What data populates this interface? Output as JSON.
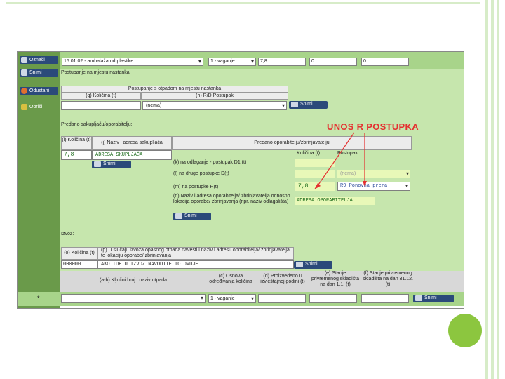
{
  "top_bar": {
    "oznaci": "Označi",
    "waste_code": "15 01 02 - ambalaža od plastike",
    "measure": "1 - vaganje",
    "qty": "7,8",
    "col5": "0",
    "col6": "0"
  },
  "sidebar": {
    "snimi": "Snimi",
    "odustani": "Odustani",
    "obrisi": "Obriši"
  },
  "postupanje": {
    "title": "Postupanje na mjestu nastanka:",
    "subheader": "Postupanje s otpadom na mjestu nastanka",
    "col_a": "(g) Količina (t)",
    "col_b": "(h) R/D Postupak",
    "select": "(nema)",
    "save": "Snimi"
  },
  "predano": {
    "title": "Predano sakupljaču/oporabitelju:",
    "h_kolicina": "(i) Količina (t)",
    "h_naziv": "(j) Naziv i adresa sakupljača",
    "h_predano": "Predano oporabitelju/zbrinjavatelju",
    "qty": "7,8",
    "adresa": "ADRESA SKUPLJAČA",
    "save1": "Snimi",
    "col_kol": "Količina (t)",
    "col_post": "Postupak",
    "row_k": "(k) na odlaganje - postupak D1 (t)",
    "row_l": "(l) na druge postupke D(t)",
    "row_l_select": "(nema)",
    "row_m": "(m) na postupke R(t)",
    "row_m_qty": "7,8",
    "row_m_select": "R9 Ponovna prera",
    "row_n": "(n) Naziv i adresa oporabitelja/ zbrinjavatelja odnosno lokacija oporabe/ zbrinjavanja (npr. naziv odlagališta)",
    "row_n_value": "ADRESA OPORABITELJA",
    "save2": "Snimi"
  },
  "callout": "UNOS R POSTUPKA",
  "izvoz": {
    "title": "Izvoz:",
    "h_kolicina": "(o) Količina (t)",
    "h_text": "(p) U slučaju izvoza opasnog otpada navesti i naziv i adresu oporabitelja/ zbrinjavatelja te lokaciju oporabe/ zbrinjavanja",
    "qty": "000000",
    "text": "AKO IDE U IZVOZ NAVODITE TO OVDJE",
    "save": "Snimi"
  },
  "bottom": {
    "h1": "(a-b) Ključni broj i naziv otpada",
    "h2": "(c) Osnova određivanja količina",
    "h3": "(d) Proizvedeno u izvještajnoj godini (t)",
    "h4": "(e) Stanje privremenog skladišta na dan 1.1. (t)",
    "h5": "(f) Stanje privremenog skladišta na dan 31.12. (t)",
    "star": "*",
    "measure": "1 - vaganje",
    "save": "Snimi"
  }
}
